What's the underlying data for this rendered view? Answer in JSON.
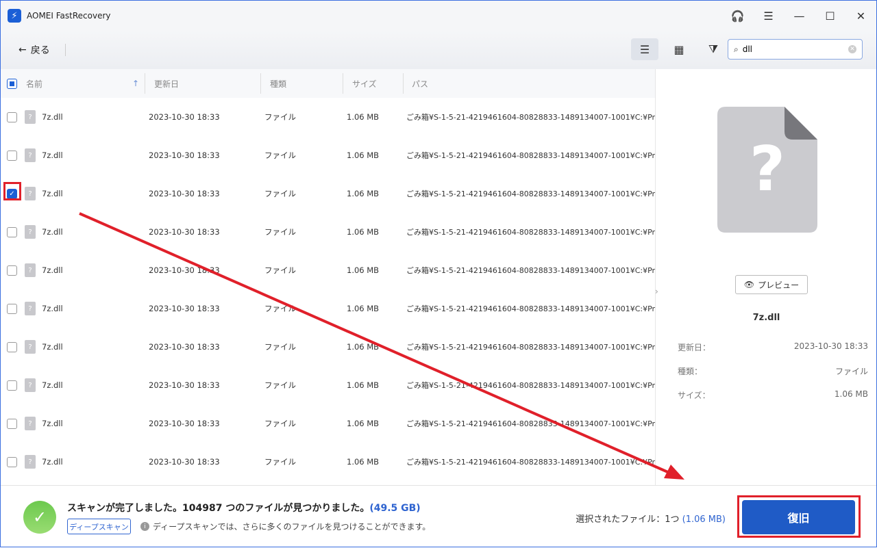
{
  "app": {
    "title": "AOMEI FastRecovery"
  },
  "toolbar": {
    "back_label": "戻る",
    "search_value": "dll"
  },
  "table": {
    "headers": {
      "name": "名前",
      "modified": "更新日",
      "type": "種類",
      "size": "サイズ",
      "path": "パス"
    },
    "rows": [
      {
        "name": "7z.dll",
        "modified": "2023-10-30 18:33",
        "type": "ファイル",
        "size": "1.06 MB",
        "path": "ごみ箱¥S-1-5-21-4219461604-80828833-1489134007-1001¥C:¥Progr...",
        "checked": false
      },
      {
        "name": "7z.dll",
        "modified": "2023-10-30 18:33",
        "type": "ファイル",
        "size": "1.06 MB",
        "path": "ごみ箱¥S-1-5-21-4219461604-80828833-1489134007-1001¥C:¥Progr...",
        "checked": false
      },
      {
        "name": "7z.dll",
        "modified": "2023-10-30 18:33",
        "type": "ファイル",
        "size": "1.06 MB",
        "path": "ごみ箱¥S-1-5-21-4219461604-80828833-1489134007-1001¥C:¥Progr...",
        "checked": true
      },
      {
        "name": "7z.dll",
        "modified": "2023-10-30 18:33",
        "type": "ファイル",
        "size": "1.06 MB",
        "path": "ごみ箱¥S-1-5-21-4219461604-80828833-1489134007-1001¥C:¥Progr...",
        "checked": false
      },
      {
        "name": "7z.dll",
        "modified": "2023-10-30 18:33",
        "type": "ファイル",
        "size": "1.06 MB",
        "path": "ごみ箱¥S-1-5-21-4219461604-80828833-1489134007-1001¥C:¥Progr...",
        "checked": false
      },
      {
        "name": "7z.dll",
        "modified": "2023-10-30 18:33",
        "type": "ファイル",
        "size": "1.06 MB",
        "path": "ごみ箱¥S-1-5-21-4219461604-80828833-1489134007-1001¥C:¥Progr...",
        "checked": false
      },
      {
        "name": "7z.dll",
        "modified": "2023-10-30 18:33",
        "type": "ファイル",
        "size": "1.06 MB",
        "path": "ごみ箱¥S-1-5-21-4219461604-80828833-1489134007-1001¥C:¥Progr...",
        "checked": false
      },
      {
        "name": "7z.dll",
        "modified": "2023-10-30 18:33",
        "type": "ファイル",
        "size": "1.06 MB",
        "path": "ごみ箱¥S-1-5-21-4219461604-80828833-1489134007-1001¥C:¥Progr...",
        "checked": false
      },
      {
        "name": "7z.dll",
        "modified": "2023-10-30 18:33",
        "type": "ファイル",
        "size": "1.06 MB",
        "path": "ごみ箱¥S-1-5-21-4219461604-80828833-1489134007-1001¥C:¥Progr...",
        "checked": false
      },
      {
        "name": "7z.dll",
        "modified": "2023-10-30 18:33",
        "type": "ファイル",
        "size": "1.06 MB",
        "path": "ごみ箱¥S-1-5-21-4219461604-80828833-1489134007-1001¥C:¥Progr...",
        "checked": false
      }
    ]
  },
  "preview": {
    "button_label": "プレビュー",
    "file_name": "7z.dll",
    "meta": [
      {
        "label": "更新日：",
        "value": "2023-10-30 18:33"
      },
      {
        "label": "種類：",
        "value": "ファイル"
      },
      {
        "label": "サイズ：",
        "value": "1.06 MB"
      }
    ]
  },
  "footer": {
    "status": "スキャンが完了しました。104987 つのファイルが見つかりました。",
    "total_size": "(49.5 GB)",
    "deep_scan_label": "ディープスキャン",
    "info_text": "ディープスキャンでは、さらに多くのファイルを見つけることができます。",
    "selected_label": "選択されたファイル：1つ",
    "selected_size": "(1.06 MB)",
    "recover_label": "復旧"
  },
  "colors": {
    "accent": "#1f5bc6",
    "annotation": "#e0202a"
  }
}
